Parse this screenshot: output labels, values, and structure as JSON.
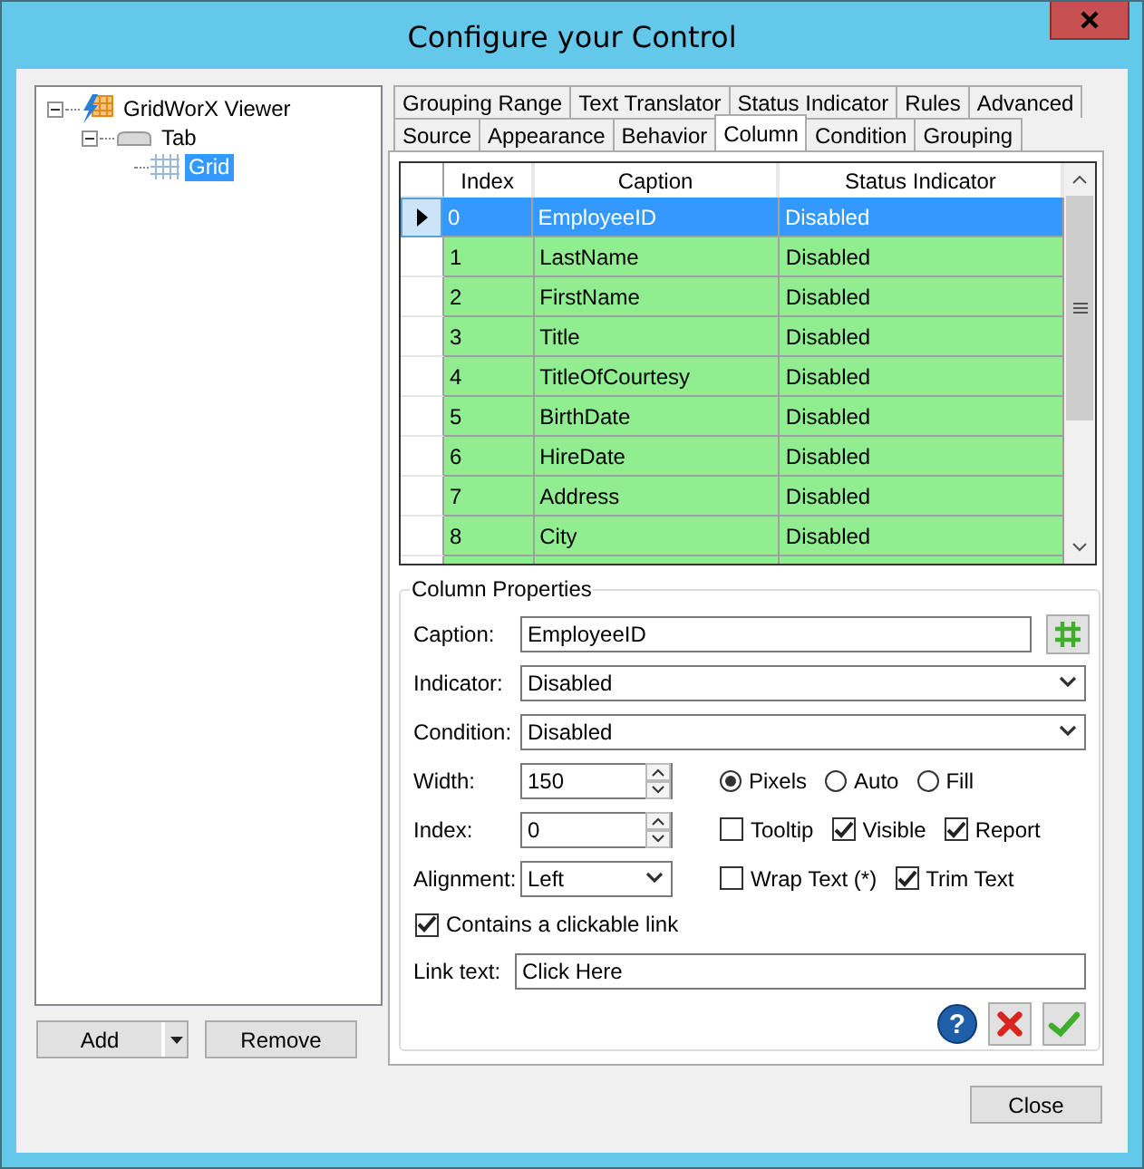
{
  "window": {
    "title": "Configure your Control"
  },
  "tree": [
    {
      "label": "GridWorX Viewer",
      "kind": "viewer",
      "expanded": true,
      "selected": false,
      "children": [
        {
          "label": "Tab",
          "kind": "tab",
          "expanded": true,
          "selected": false,
          "children": [
            {
              "label": "Grid",
              "kind": "grid",
              "selected": true
            }
          ]
        }
      ]
    }
  ],
  "add_button": {
    "label": "Add"
  },
  "remove_button": {
    "label": "Remove"
  },
  "tab_rows": [
    [
      {
        "label": "Grouping Range",
        "selected": false
      },
      {
        "label": "Text Translator",
        "selected": false
      },
      {
        "label": "Status Indicator",
        "selected": false
      },
      {
        "label": "Rules",
        "selected": false
      },
      {
        "label": "Advanced",
        "selected": false
      }
    ],
    [
      {
        "label": "Source",
        "selected": false
      },
      {
        "label": "Appearance",
        "selected": false
      },
      {
        "label": "Behavior",
        "selected": false
      },
      {
        "label": "Column",
        "selected": true
      },
      {
        "label": "Condition",
        "selected": false
      },
      {
        "label": "Grouping",
        "selected": false
      }
    ]
  ],
  "grid": {
    "columns": [
      "Index",
      "Caption",
      "Status Indicator"
    ],
    "rows": [
      {
        "index": "0",
        "caption": "EmployeeID",
        "status": "Disabled",
        "selected": true
      },
      {
        "index": "1",
        "caption": "LastName",
        "status": "Disabled",
        "selected": false
      },
      {
        "index": "2",
        "caption": "FirstName",
        "status": "Disabled",
        "selected": false
      },
      {
        "index": "3",
        "caption": "Title",
        "status": "Disabled",
        "selected": false
      },
      {
        "index": "4",
        "caption": "TitleOfCourtesy",
        "status": "Disabled",
        "selected": false
      },
      {
        "index": "5",
        "caption": "BirthDate",
        "status": "Disabled",
        "selected": false
      },
      {
        "index": "6",
        "caption": "HireDate",
        "status": "Disabled",
        "selected": false
      },
      {
        "index": "7",
        "caption": "Address",
        "status": "Disabled",
        "selected": false
      },
      {
        "index": "8",
        "caption": "City",
        "status": "Disabled",
        "selected": false
      }
    ]
  },
  "column_properties": {
    "title": "Column Properties",
    "caption": {
      "label": "Caption:",
      "value": "EmployeeID"
    },
    "indicator": {
      "label": "Indicator:",
      "value": "Disabled"
    },
    "condition": {
      "label": "Condition:",
      "value": "Disabled"
    },
    "width": {
      "label": "Width:",
      "value": "150"
    },
    "index": {
      "label": "Index:",
      "value": "0"
    },
    "alignment": {
      "label": "Alignment:",
      "value": "Left"
    },
    "size_modes": [
      {
        "label": "Pixels",
        "selected": true
      },
      {
        "label": "Auto",
        "selected": false
      },
      {
        "label": "Fill",
        "selected": false
      }
    ],
    "flag_rows": [
      [
        {
          "label": "Tooltip",
          "checked": false
        },
        {
          "label": "Visible",
          "checked": true
        },
        {
          "label": "Report",
          "checked": true
        }
      ],
      [
        {
          "label": "Wrap Text (*)",
          "checked": false
        },
        {
          "label": "Trim Text",
          "checked": true
        }
      ]
    ],
    "clickable_link": {
      "label": "Contains a clickable link",
      "checked": true
    },
    "link_text": {
      "label": "Link text:",
      "value": "Click Here"
    },
    "help_button": "?"
  },
  "close_button": {
    "label": "Close"
  }
}
